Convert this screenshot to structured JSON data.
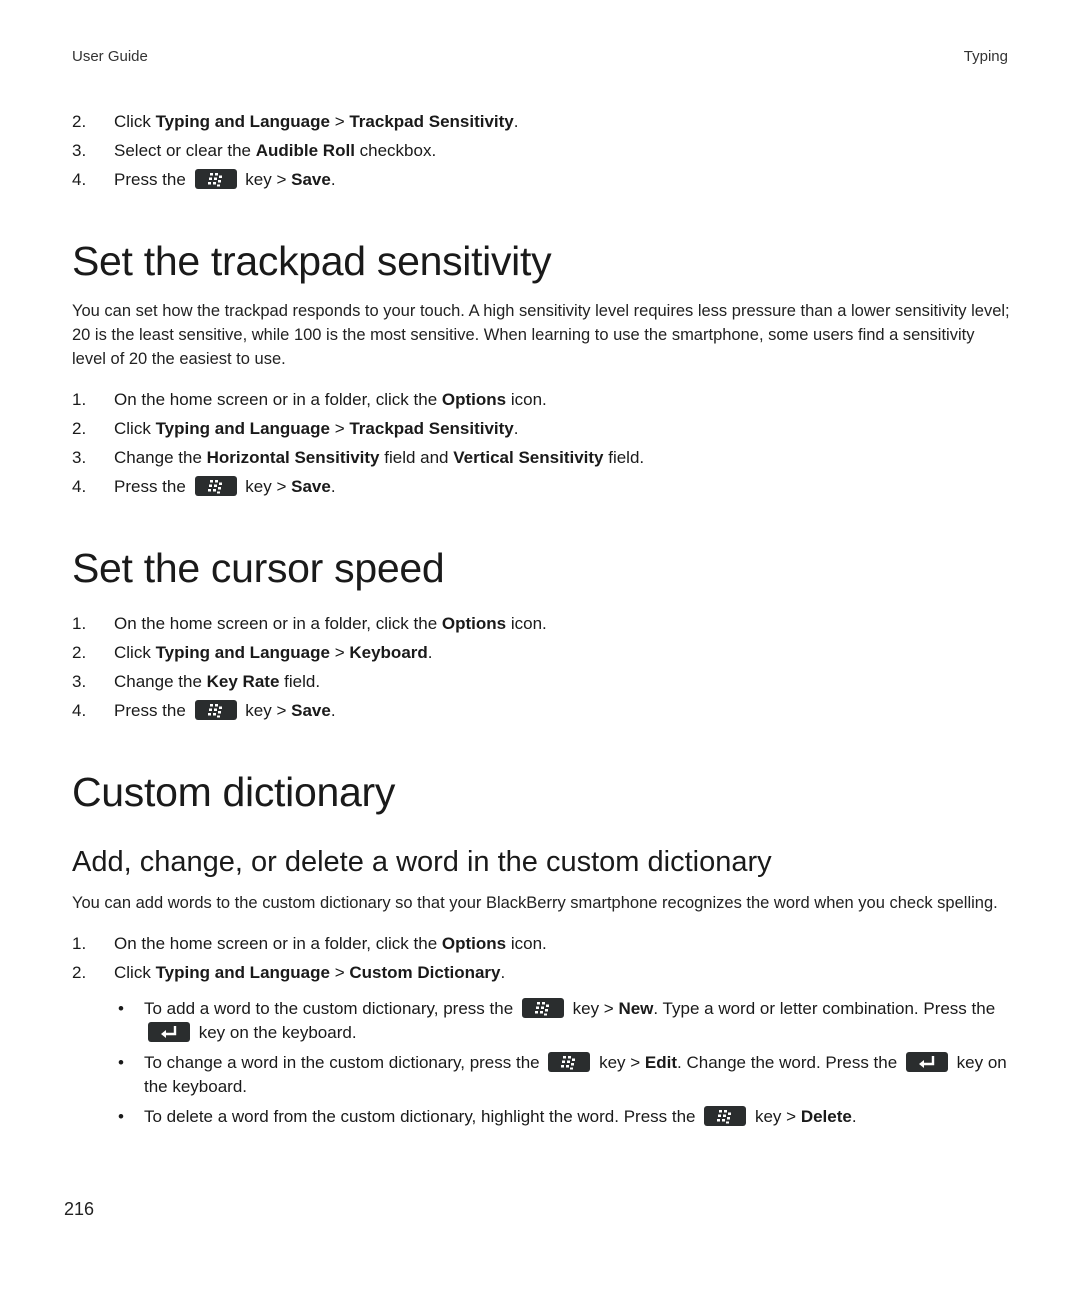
{
  "header": {
    "left": "User Guide",
    "right": "Typing"
  },
  "intro_steps": [
    {
      "num": "2.",
      "parts": [
        {
          "t": "Click "
        },
        {
          "b": "Typing and Language"
        },
        {
          "t": " > "
        },
        {
          "b": "Trackpad Sensitivity"
        },
        {
          "t": "."
        }
      ]
    },
    {
      "num": "3.",
      "parts": [
        {
          "t": "Select or clear the "
        },
        {
          "b": "Audible Roll"
        },
        {
          "t": " checkbox."
        }
      ]
    },
    {
      "num": "4.",
      "parts": [
        {
          "t": "Press the "
        },
        {
          "key": "menu"
        },
        {
          "t": " key > "
        },
        {
          "b": "Save"
        },
        {
          "t": "."
        }
      ]
    }
  ],
  "sections": {
    "trackpad": {
      "title": "Set the trackpad sensitivity",
      "body": "You can set how the trackpad responds to your touch. A high sensitivity level requires less pressure than a lower sensitivity level; 20 is the least sensitive, while 100 is the most sensitive. When learning to use the smartphone, some users find a sensitivity level of 20 the easiest to use.",
      "steps": [
        {
          "num": "1.",
          "parts": [
            {
              "t": "On the home screen or in a folder, click the "
            },
            {
              "b": "Options"
            },
            {
              "t": " icon."
            }
          ]
        },
        {
          "num": "2.",
          "parts": [
            {
              "t": "Click "
            },
            {
              "b": "Typing and Language"
            },
            {
              "t": " > "
            },
            {
              "b": "Trackpad Sensitivity"
            },
            {
              "t": "."
            }
          ]
        },
        {
          "num": "3.",
          "parts": [
            {
              "t": "Change the "
            },
            {
              "b": "Horizontal Sensitivity"
            },
            {
              "t": " field and "
            },
            {
              "b": "Vertical Sensitivity"
            },
            {
              "t": " field."
            }
          ]
        },
        {
          "num": "4.",
          "parts": [
            {
              "t": "Press the "
            },
            {
              "key": "menu"
            },
            {
              "t": " key > "
            },
            {
              "b": "Save"
            },
            {
              "t": "."
            }
          ]
        }
      ]
    },
    "cursor": {
      "title": "Set the cursor speed",
      "steps": [
        {
          "num": "1.",
          "parts": [
            {
              "t": "On the home screen or in a folder, click the "
            },
            {
              "b": "Options"
            },
            {
              "t": " icon."
            }
          ]
        },
        {
          "num": "2.",
          "parts": [
            {
              "t": "Click "
            },
            {
              "b": "Typing and Language"
            },
            {
              "t": " > "
            },
            {
              "b": "Keyboard"
            },
            {
              "t": "."
            }
          ]
        },
        {
          "num": "3.",
          "parts": [
            {
              "t": "Change the "
            },
            {
              "b": "Key Rate"
            },
            {
              "t": " field."
            }
          ]
        },
        {
          "num": "4.",
          "parts": [
            {
              "t": "Press the "
            },
            {
              "key": "menu"
            },
            {
              "t": " key > "
            },
            {
              "b": "Save"
            },
            {
              "t": "."
            }
          ]
        }
      ]
    },
    "dictionary": {
      "title": "Custom dictionary",
      "subtitle": "Add, change, or delete a word in the custom dictionary",
      "body": "You can add words to the custom dictionary so that your BlackBerry smartphone recognizes the word when you check spelling.",
      "steps": [
        {
          "num": "1.",
          "parts": [
            {
              "t": "On the home screen or in a folder, click the "
            },
            {
              "b": "Options"
            },
            {
              "t": " icon."
            }
          ]
        },
        {
          "num": "2.",
          "parts": [
            {
              "t": "Click "
            },
            {
              "b": "Typing and Language"
            },
            {
              "t": " > "
            },
            {
              "b": "Custom Dictionary"
            },
            {
              "t": "."
            }
          ]
        }
      ],
      "bullets": [
        {
          "parts": [
            {
              "t": "To add a word to the custom dictionary, press the "
            },
            {
              "key": "menu"
            },
            {
              "t": " key > "
            },
            {
              "b": "New"
            },
            {
              "t": ". Type a word or letter combination. Press the "
            },
            {
              "key": "enter"
            },
            {
              "t": " key on the keyboard."
            }
          ]
        },
        {
          "parts": [
            {
              "t": "To change a word in the custom dictionary, press the "
            },
            {
              "key": "menu"
            },
            {
              "t": " key > "
            },
            {
              "b": "Edit"
            },
            {
              "t": ". Change the word. Press the "
            },
            {
              "key": "enter"
            },
            {
              "t": " key on the keyboard."
            }
          ]
        },
        {
          "parts": [
            {
              "t": "To delete a word from the custom dictionary, highlight the word. Press the "
            },
            {
              "key": "menu"
            },
            {
              "t": " key > "
            },
            {
              "b": "Delete"
            },
            {
              "t": "."
            }
          ]
        }
      ]
    }
  },
  "bullet_glyph": "•",
  "page_number": "216",
  "colors": {
    "key_bg": "#2a2d2e",
    "text": "#1a1a1a"
  }
}
